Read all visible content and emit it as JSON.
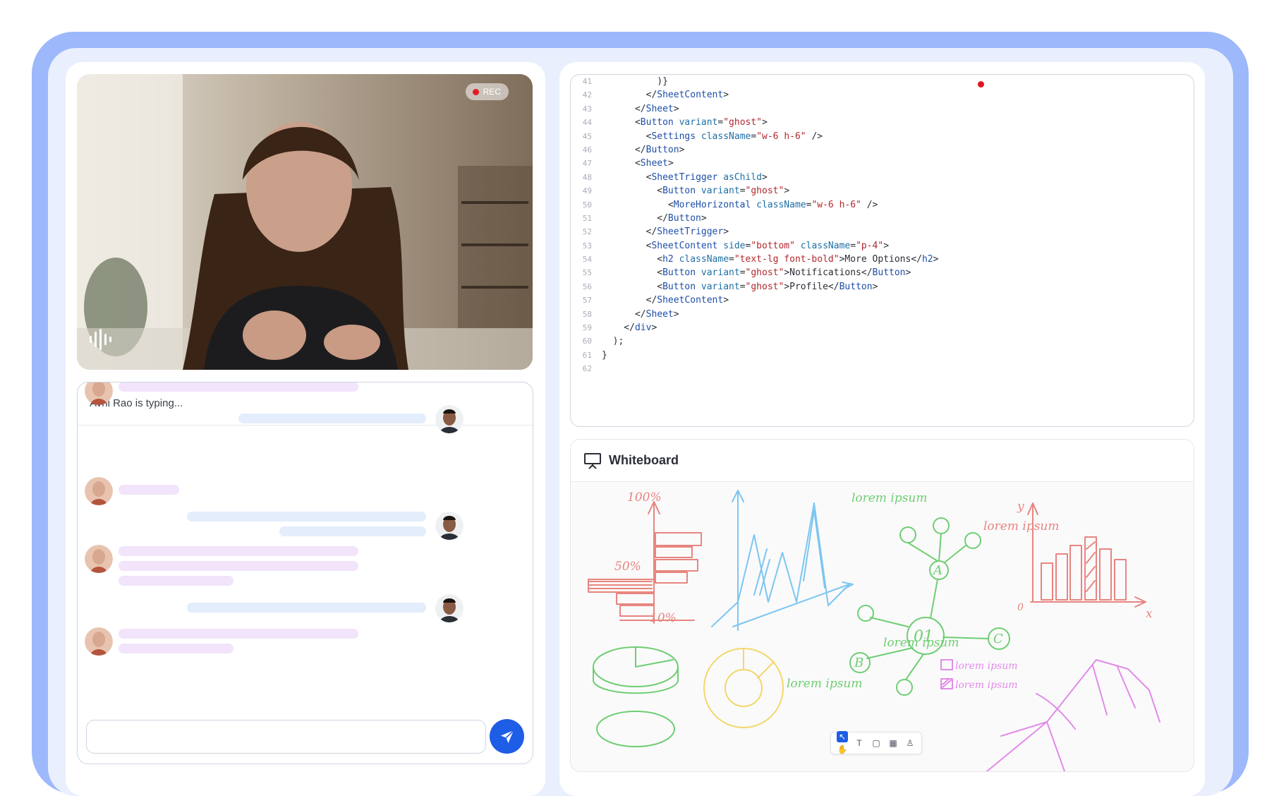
{
  "video": {
    "rec_label": "REC"
  },
  "chat": {
    "typing_status": "Avni Rao is typing...",
    "input_placeholder": ""
  },
  "code": {
    "lines": [
      {
        "n": "41",
        "parts": [
          {
            "t": "plain",
            "v": "          )}"
          }
        ]
      },
      {
        "n": "42",
        "parts": [
          {
            "t": "plain",
            "v": "        </"
          },
          {
            "t": "tag",
            "v": "SheetContent"
          },
          {
            "t": "plain",
            "v": ">"
          }
        ]
      },
      {
        "n": "43",
        "parts": [
          {
            "t": "plain",
            "v": "      </"
          },
          {
            "t": "tag",
            "v": "Sheet"
          },
          {
            "t": "plain",
            "v": ">"
          }
        ]
      },
      {
        "n": "44",
        "parts": [
          {
            "t": "plain",
            "v": "      <"
          },
          {
            "t": "tag",
            "v": "Button"
          },
          {
            "t": "attr",
            "v": " variant"
          },
          {
            "t": "plain",
            "v": "="
          },
          {
            "t": "str",
            "v": "\"ghost\""
          },
          {
            "t": "plain",
            "v": ">"
          }
        ]
      },
      {
        "n": "45",
        "parts": [
          {
            "t": "plain",
            "v": "        <"
          },
          {
            "t": "tag",
            "v": "Settings"
          },
          {
            "t": "attr",
            "v": " className"
          },
          {
            "t": "plain",
            "v": "="
          },
          {
            "t": "str",
            "v": "\"w-6 h-6\""
          },
          {
            "t": "plain",
            "v": " />"
          }
        ]
      },
      {
        "n": "46",
        "parts": [
          {
            "t": "plain",
            "v": "      </"
          },
          {
            "t": "tag",
            "v": "Button"
          },
          {
            "t": "plain",
            "v": ">"
          }
        ]
      },
      {
        "n": "47",
        "parts": [
          {
            "t": "plain",
            "v": "      <"
          },
          {
            "t": "tag",
            "v": "Sheet"
          },
          {
            "t": "plain",
            "v": ">"
          }
        ]
      },
      {
        "n": "48",
        "parts": [
          {
            "t": "plain",
            "v": "        <"
          },
          {
            "t": "tag",
            "v": "SheetTrigger"
          },
          {
            "t": "attr",
            "v": " asChild"
          },
          {
            "t": "plain",
            "v": ">"
          }
        ]
      },
      {
        "n": "49",
        "parts": [
          {
            "t": "plain",
            "v": "          <"
          },
          {
            "t": "tag",
            "v": "Button"
          },
          {
            "t": "attr",
            "v": " variant"
          },
          {
            "t": "plain",
            "v": "="
          },
          {
            "t": "str",
            "v": "\"ghost\""
          },
          {
            "t": "plain",
            "v": ">"
          }
        ]
      },
      {
        "n": "50",
        "parts": [
          {
            "t": "plain",
            "v": "            <"
          },
          {
            "t": "tag",
            "v": "MoreHorizontal"
          },
          {
            "t": "attr",
            "v": " className"
          },
          {
            "t": "plain",
            "v": "="
          },
          {
            "t": "str",
            "v": "\"w-6 h-6\""
          },
          {
            "t": "plain",
            "v": " />"
          }
        ]
      },
      {
        "n": "51",
        "parts": [
          {
            "t": "plain",
            "v": "          </"
          },
          {
            "t": "tag",
            "v": "Button"
          },
          {
            "t": "plain",
            "v": ">"
          }
        ]
      },
      {
        "n": "52",
        "parts": [
          {
            "t": "plain",
            "v": "        </"
          },
          {
            "t": "tag",
            "v": "SheetTrigger"
          },
          {
            "t": "plain",
            "v": ">"
          }
        ]
      },
      {
        "n": "53",
        "parts": [
          {
            "t": "plain",
            "v": "        <"
          },
          {
            "t": "tag",
            "v": "SheetContent"
          },
          {
            "t": "attr",
            "v": " side"
          },
          {
            "t": "plain",
            "v": "="
          },
          {
            "t": "str",
            "v": "\"bottom\""
          },
          {
            "t": "attr",
            "v": " className"
          },
          {
            "t": "plain",
            "v": "="
          },
          {
            "t": "str",
            "v": "\"p-4\""
          },
          {
            "t": "plain",
            "v": ">"
          }
        ]
      },
      {
        "n": "54",
        "parts": [
          {
            "t": "plain",
            "v": "          <"
          },
          {
            "t": "tag",
            "v": "h2"
          },
          {
            "t": "attr",
            "v": " className"
          },
          {
            "t": "plain",
            "v": "="
          },
          {
            "t": "str",
            "v": "\"text-lg font-bold\""
          },
          {
            "t": "plain",
            "v": ">More Options</"
          },
          {
            "t": "tag",
            "v": "h2"
          },
          {
            "t": "plain",
            "v": ">"
          }
        ]
      },
      {
        "n": "55",
        "parts": [
          {
            "t": "plain",
            "v": "          <"
          },
          {
            "t": "tag",
            "v": "Button"
          },
          {
            "t": "attr",
            "v": " variant"
          },
          {
            "t": "plain",
            "v": "="
          },
          {
            "t": "str",
            "v": "\"ghost\""
          },
          {
            "t": "plain",
            "v": ">Notifications</"
          },
          {
            "t": "tag",
            "v": "Button"
          },
          {
            "t": "plain",
            "v": ">"
          }
        ]
      },
      {
        "n": "56",
        "parts": [
          {
            "t": "plain",
            "v": "          <"
          },
          {
            "t": "tag",
            "v": "Button"
          },
          {
            "t": "attr",
            "v": " variant"
          },
          {
            "t": "plain",
            "v": "="
          },
          {
            "t": "str",
            "v": "\"ghost\""
          },
          {
            "t": "plain",
            "v": ">Profile</"
          },
          {
            "t": "tag",
            "v": "Button"
          },
          {
            "t": "plain",
            "v": ">"
          }
        ]
      },
      {
        "n": "57",
        "parts": [
          {
            "t": "plain",
            "v": "        </"
          },
          {
            "t": "tag",
            "v": "SheetContent"
          },
          {
            "t": "plain",
            "v": ">"
          }
        ]
      },
      {
        "n": "58",
        "parts": [
          {
            "t": "plain",
            "v": "      </"
          },
          {
            "t": "tag",
            "v": "Sheet"
          },
          {
            "t": "plain",
            "v": ">"
          }
        ]
      },
      {
        "n": "59",
        "parts": [
          {
            "t": "plain",
            "v": "    </"
          },
          {
            "t": "tag",
            "v": "div"
          },
          {
            "t": "plain",
            "v": ">"
          }
        ]
      },
      {
        "n": "60",
        "parts": [
          {
            "t": "plain",
            "v": "  );"
          }
        ]
      },
      {
        "n": "61",
        "parts": [
          {
            "t": "plain",
            "v": "}"
          }
        ]
      },
      {
        "n": "62",
        "parts": [
          {
            "t": "plain",
            "v": ""
          }
        ]
      }
    ]
  },
  "whiteboard": {
    "title": "Whiteboard",
    "labels": {
      "pct100": "100%",
      "pct50": "50%",
      "pct10": "10%",
      "lorem_top": "lorem ipsum",
      "lorem_chart": "lorem ipsum",
      "lorem_c": "lorem ipsum",
      "lorem_bottom": "lorem ipsum",
      "legend1": "lorem ipsum",
      "legend2": "lorem ipsum",
      "node_a": "A",
      "node_b": "B",
      "node_c": "C",
      "node_center": "01",
      "axis_y": "y",
      "axis_x": "x",
      "axis_origin": "0"
    },
    "toolbar_text_tool": "T"
  },
  "colors": {
    "frame": "#9db8fb",
    "send_button": "#1e5de6",
    "rec_dot": "#e31b23",
    "chalk_red": "#e8857f",
    "chalk_blue": "#7cc6f0",
    "chalk_green": "#6fce72",
    "chalk_yellow": "#f3d76b",
    "chalk_purple": "#e28be9"
  }
}
